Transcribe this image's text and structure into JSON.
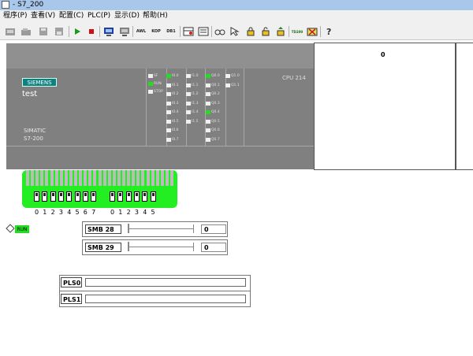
{
  "window": {
    "title": "- S7_200"
  },
  "menu": [
    "程序(P)",
    "查看(V)",
    "配置(C)",
    "PLC(P)",
    "显示(D)",
    "帮助(H)"
  ],
  "toolbar": [
    {
      "icon": "new-icon",
      "label": ""
    },
    {
      "icon": "open-icon",
      "label": ""
    },
    {
      "icon": "save-icon",
      "label": ""
    },
    {
      "icon": "save-as-icon",
      "label": ""
    },
    {
      "icon": "run-icon",
      "label": ""
    },
    {
      "icon": "stop-icon",
      "label": ""
    },
    {
      "icon": "monitor-icon",
      "label": ""
    },
    {
      "icon": "program-icon",
      "label": ""
    },
    {
      "icon": "awl-text",
      "label": "AWL"
    },
    {
      "icon": "kop-text",
      "label": "KOP"
    },
    {
      "icon": "db1-text",
      "label": "DB1"
    },
    {
      "icon": "state-table-icon",
      "label": ""
    },
    {
      "icon": "status-icon",
      "label": ""
    },
    {
      "icon": "glasses-icon",
      "label": ""
    },
    {
      "icon": "pointer-icon",
      "label": ""
    },
    {
      "icon": "lock-icon",
      "label": ""
    },
    {
      "icon": "unlock-icon",
      "label": ""
    },
    {
      "icon": "up-lock-icon",
      "label": ""
    },
    {
      "icon": "tp-icon",
      "label": "TD200"
    },
    {
      "icon": "tools-icon",
      "label": ""
    },
    {
      "icon": "help-icon",
      "label": ""
    }
  ],
  "plc": {
    "brand": "SIEMENS",
    "name": "test",
    "series": [
      "SIMATIC",
      "S7-200"
    ],
    "cpu": "CPU 214",
    "status_leds": [
      {
        "label": "SF",
        "on": false
      },
      {
        "label": "RUN",
        "on": true
      },
      {
        "label": "STOP",
        "on": false
      }
    ],
    "inputs0": [
      {
        "label": "I0.0",
        "on": true
      },
      {
        "label": "I0.1",
        "on": false
      },
      {
        "label": "I0.2",
        "on": false
      },
      {
        "label": "I0.3",
        "on": false
      },
      {
        "label": "I0.4",
        "on": false
      },
      {
        "label": "I0.5",
        "on": false
      },
      {
        "label": "I0.6",
        "on": false
      },
      {
        "label": "I0.7",
        "on": false
      }
    ],
    "inputs1": [
      {
        "label": "I1.0",
        "on": false
      },
      {
        "label": "I1.1",
        "on": false
      },
      {
        "label": "I1.2",
        "on": false
      },
      {
        "label": "I1.3",
        "on": false
      },
      {
        "label": "I1.4",
        "on": false
      },
      {
        "label": "I1.5",
        "on": false
      }
    ],
    "outputs0": [
      {
        "label": "Q0.0",
        "on": true
      },
      {
        "label": "Q0.1",
        "on": false
      },
      {
        "label": "Q0.2",
        "on": false
      },
      {
        "label": "Q0.3",
        "on": false
      },
      {
        "label": "Q0.4",
        "on": true
      },
      {
        "label": "Q0.5",
        "on": false
      },
      {
        "label": "Q0.6",
        "on": false
      },
      {
        "label": "Q0.7",
        "on": false
      }
    ],
    "outputs1": [
      {
        "label": "Q1.0",
        "on": false
      },
      {
        "label": "Q1.1",
        "on": false
      }
    ]
  },
  "counter_panel": {
    "value": "0"
  },
  "switches": {
    "group0": [
      "0",
      "1",
      "2",
      "3",
      "4",
      "5",
      "6",
      "7"
    ],
    "group1": [
      "0",
      "1",
      "2",
      "3",
      "4",
      "5"
    ]
  },
  "run_indicator": "RUN",
  "smb": [
    {
      "label": "SMB 28",
      "value": "0"
    },
    {
      "label": "SMB 29",
      "value": "0"
    }
  ],
  "pls": [
    {
      "label": "PLS0"
    },
    {
      "label": "PLS1"
    }
  ]
}
